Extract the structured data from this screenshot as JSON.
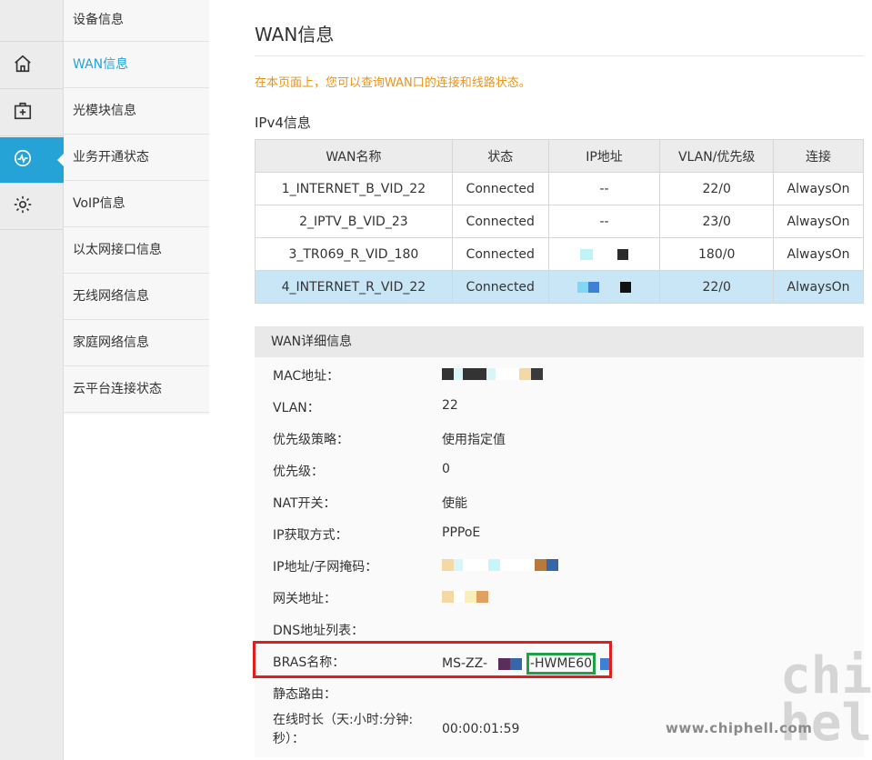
{
  "sidebar": {
    "items": [
      {
        "label": "设备信息",
        "active": false
      },
      {
        "label": "WAN信息",
        "active": true
      },
      {
        "label": "光模块信息",
        "active": false
      },
      {
        "label": "业务开通状态",
        "active": false
      },
      {
        "label": "VoIP信息",
        "active": false
      },
      {
        "label": "以太网接口信息",
        "active": false
      },
      {
        "label": "无线网络信息",
        "active": false
      },
      {
        "label": "家庭网络信息",
        "active": false
      },
      {
        "label": "云平台连接状态",
        "active": false
      }
    ]
  },
  "rail": {
    "icons": [
      "home-icon",
      "first-aid-kit-icon",
      "status-monitor-icon",
      "gear-icon"
    ],
    "active_color": "#26a3d6"
  },
  "page": {
    "title": "WAN信息",
    "notice": "在本页面上，您可以查询WAN口的连接和线路状态。",
    "ipv4_title": "IPv4信息"
  },
  "wan_table": {
    "headers": [
      "WAN名称",
      "状态",
      "IP地址",
      "VLAN/优先级",
      "连接"
    ],
    "rows": [
      [
        "1_INTERNET_B_VID_22",
        "Connected",
        "--",
        "22/0",
        "AlwaysOn"
      ],
      [
        "2_IPTV_B_VID_23",
        "Connected",
        "--",
        "23/0",
        "AlwaysOn"
      ],
      [
        "3_TR069_R_VID_180",
        "Connected",
        "",
        "180/0",
        "AlwaysOn"
      ],
      [
        "4_INTERNET_R_VID_22",
        "Connected",
        "",
        "22/0",
        "AlwaysOn"
      ]
    ]
  },
  "details": {
    "header": "WAN详细信息",
    "labels": {
      "mac": "MAC地址：",
      "vlan": "VLAN：",
      "priority_policy": "优先级策略：",
      "priority": "优先级：",
      "nat": "NAT开关：",
      "ip_mode": "IP获取方式：",
      "ip_mask": "IP地址/子网掩码：",
      "gateway": "网关地址：",
      "dns": "DNS地址列表：",
      "bras": "BRAS名称：",
      "static_route": "静态路由：",
      "online_time": "在线时长（天:小时:分钟:秒）："
    },
    "values": {
      "vlan": "22",
      "priority_policy": "使用指定值",
      "priority": "0",
      "nat": "使能",
      "ip_mode": "PPPoE",
      "bras_prefix": "MS-ZZ-",
      "bras_highlight": "-HWME60",
      "online_time": "00:00:01:59"
    }
  },
  "watermark": {
    "text": "www.chiphell.com",
    "logo": "chip hell"
  }
}
